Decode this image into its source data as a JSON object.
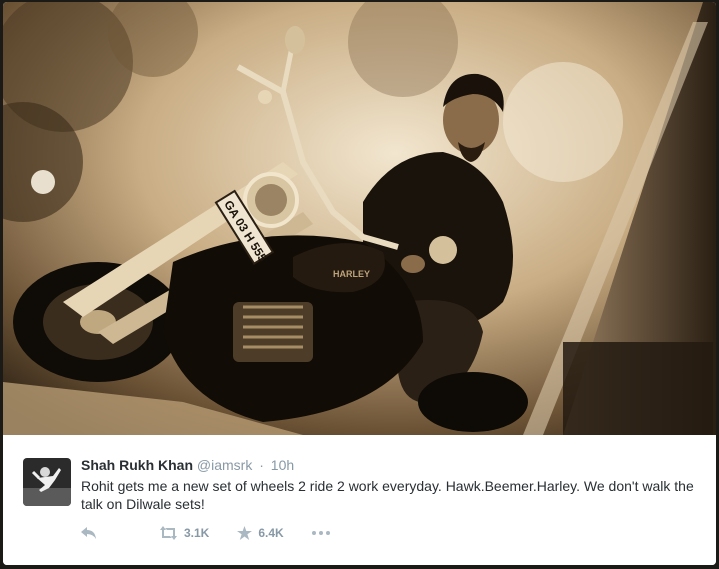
{
  "photo": {
    "alt_icon": "photo-image",
    "plate_lines": [
      "GA 03 H 555"
    ],
    "tank_badge": "HARLEY"
  },
  "tweet": {
    "display_name": "Shah Rukh Khan",
    "handle": "@iamsrk",
    "separator": "·",
    "time": "10h",
    "text": "Rohit gets me a new set of wheels 2 ride 2 work everyday. Hawk.Beemer.Harley. We don't walk the talk on Dilwale sets!",
    "actions": {
      "reply_icon": "reply-icon",
      "retweet_icon": "retweet-icon",
      "retweet_count": "3.1K",
      "favorite_icon": "star-icon",
      "favorite_count": "6.4K",
      "more_icon": "more-icon"
    }
  },
  "colors": {
    "name": "#292f33",
    "meta": "#8899a6",
    "icon": "#aab8c2",
    "sepia_light": "#e8d9bd",
    "sepia_dark": "#1e160c"
  }
}
